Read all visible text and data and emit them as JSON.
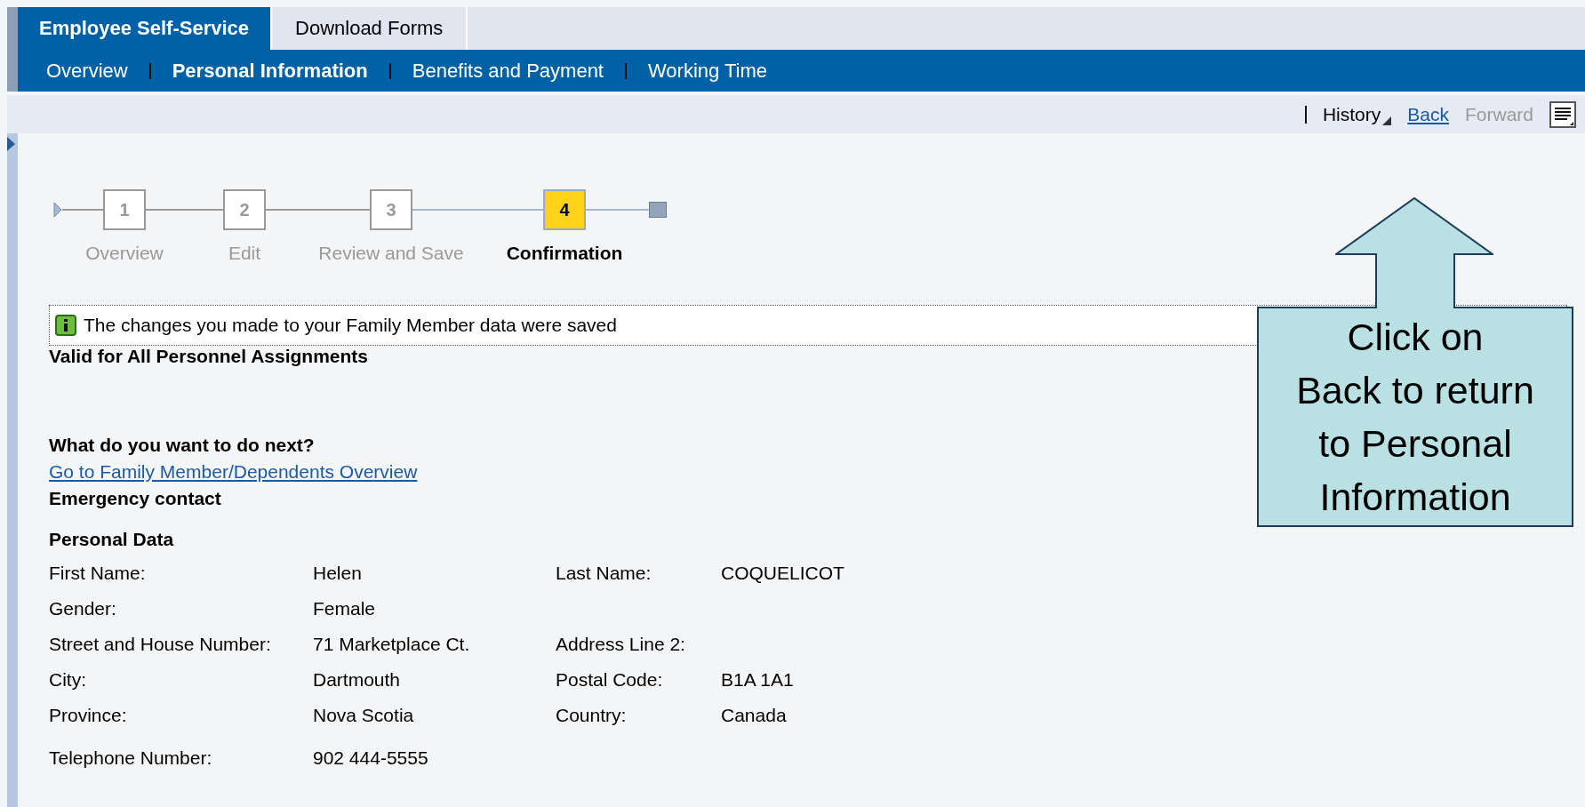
{
  "top_tabs": [
    {
      "label": "Employee Self-Service",
      "selected": true
    },
    {
      "label": "Download Forms",
      "selected": false
    }
  ],
  "nav": [
    {
      "label": "Overview",
      "selected": false
    },
    {
      "label": "Personal Information",
      "selected": true
    },
    {
      "label": "Benefits and Payment",
      "selected": false
    },
    {
      "label": "Working Time",
      "selected": false
    }
  ],
  "toolbar": {
    "history": "History",
    "links": [
      {
        "label": "Back",
        "disabled": false
      },
      {
        "label": "Forward",
        "disabled": true
      }
    ]
  },
  "steps": [
    {
      "number": "1",
      "label": "Overview",
      "selected": false
    },
    {
      "number": "2",
      "label": "Edit",
      "selected": false
    },
    {
      "number": "3",
      "label": "Review and Save",
      "selected": false
    },
    {
      "number": "4",
      "label": "Confirmation",
      "selected": true
    }
  ],
  "message": {
    "text": "The changes you made to your Family Member data were saved"
  },
  "assignment": "Valid for All Personnel Assignments",
  "next": {
    "heading": "What do you want to do next?",
    "link": "Go to Family Member/Dependents Overview",
    "emergency": "Emergency contact"
  },
  "personal_data": {
    "title": "Personal Data",
    "rows": [
      [
        {
          "label": "First Name:",
          "value": "Helen"
        },
        {
          "label": "Last Name:",
          "value": "COQUELICOT"
        }
      ],
      [
        {
          "label": "Gender:",
          "value": "Female"
        }
      ],
      [
        {
          "label": "Street and House Number:",
          "value": "71 Marketplace Ct."
        },
        {
          "label": "Address Line 2:"
        }
      ],
      [
        {
          "label": "City:",
          "value": "Dartmouth"
        },
        {
          "label": "Postal Code:",
          "value": "B1A 1A1"
        }
      ],
      [
        {
          "label": "Province:",
          "value": "Nova Scotia"
        },
        {
          "label": "Country:",
          "value": "Canada"
        }
      ],
      [
        {
          "label": "Telephone Number:",
          "value": "902  444-5555"
        }
      ]
    ]
  },
  "callout": {
    "text": "Click on\nBack to return\nto Personal\nInformation"
  }
}
